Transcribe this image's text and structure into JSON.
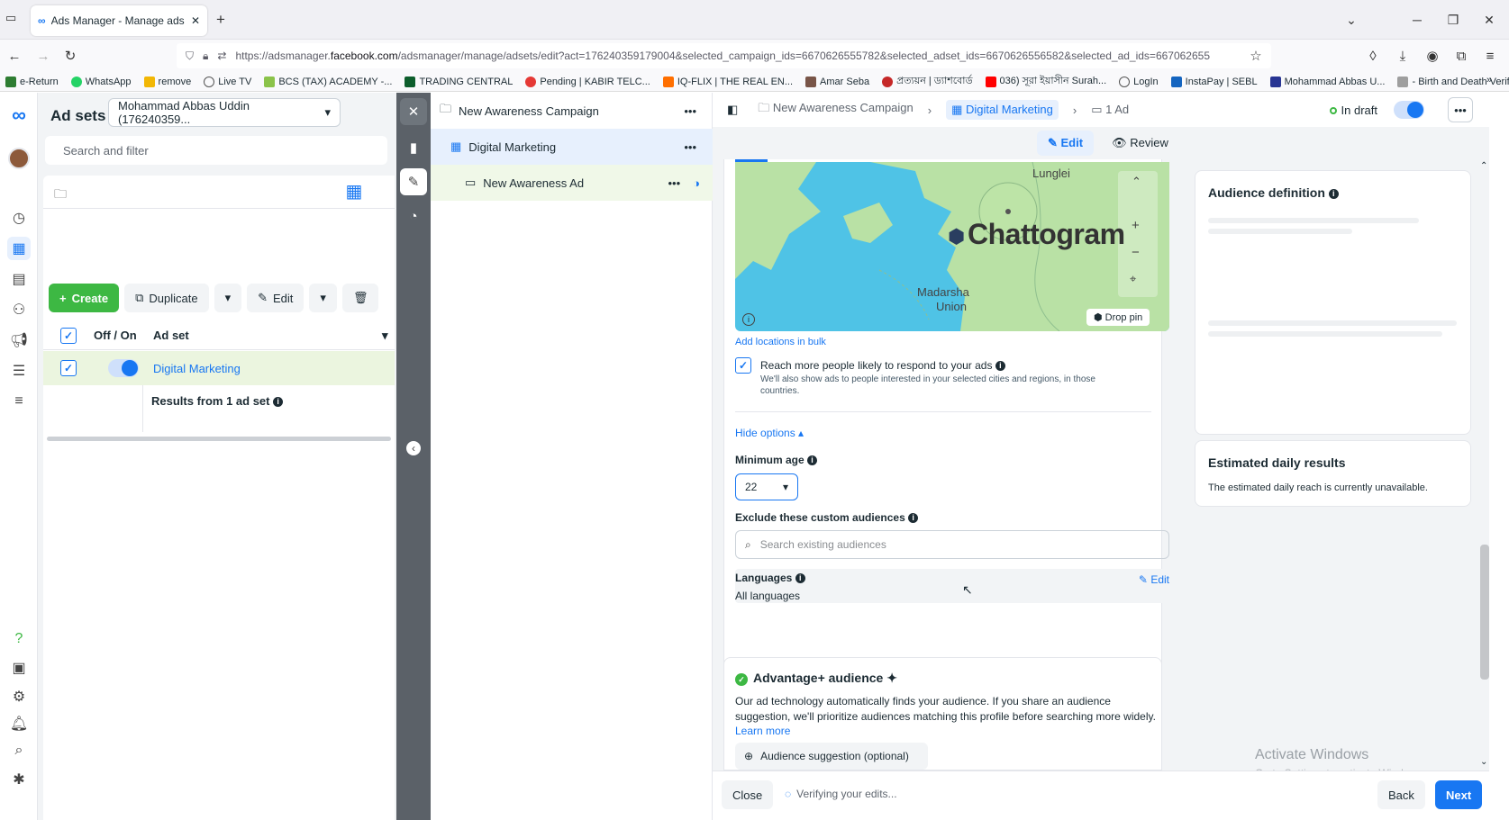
{
  "browser": {
    "tab_title": "Ads Manager - Manage ads - A",
    "url_prefix": "https://adsmanager.",
    "url_domain": "facebook.com",
    "url_rest": "/adsmanager/manage/adsets/edit?act=176240359179004&selected_campaign_ids=6670626555782&selected_adset_ids=6670626556582&selected_ad_ids=667062655",
    "bookmarks": [
      "e-Return",
      "WhatsApp",
      "remove",
      "Live TV",
      "BCS (TAX) ACADEMY -...",
      "TRADING CENTRAL",
      "Pending | KABIR TELC...",
      "IQ-FLIX | THE REAL EN...",
      "Amar Seba",
      "প্রত্যয়ন | ড্যাশবোর্ড",
      "036) সূরা ইয়াসীন Surah...",
      "LogIn",
      "InstaPay | SEBL",
      "Mohammad Abbas U...",
      "- Birth and Death Verifi..."
    ]
  },
  "adsets_panel": {
    "title": "Ad sets",
    "account": "Mohammad Abbas Uddin (176240359...",
    "search_placeholder": "Search and filter",
    "create_label": "Create",
    "duplicate_label": "Duplicate",
    "edit_label": "Edit",
    "col_toggle": "Off / On",
    "col_adset": "Ad set",
    "row_name": "Digital Marketing",
    "results_text": "Results from 1 ad set"
  },
  "tree": {
    "campaign": "New Awareness Campaign",
    "adset": "Digital Marketing",
    "ad": "New Awareness Ad"
  },
  "editor": {
    "breadcrumb_campaign": "New Awareness Campaign",
    "breadcrumb_adset": "Digital Marketing",
    "breadcrumb_ad": "1 Ad",
    "status": "In draft",
    "edit_tab": "Edit",
    "review_tab": "Review",
    "map": {
      "city": "Chattogram",
      "place_1": "Lunglei",
      "place_2": "Madarsha",
      "place_3": "Union",
      "drop_pin": "Drop pin"
    },
    "add_bulk": "Add locations in bulk",
    "reach_more_title": "Reach more people likely to respond to your ads",
    "reach_more_desc": "We'll also show ads to people interested in your selected cities and regions, in those countries.",
    "hide_options": "Hide options",
    "min_age_label": "Minimum age",
    "min_age_value": "22",
    "exclude_label": "Exclude these custom audiences",
    "exclude_placeholder": "Search existing audiences",
    "languages_label": "Languages",
    "languages_edit": "Edit",
    "languages_value": "All languages",
    "advantage_title": "Advantage+ audience",
    "advantage_desc": "Our ad technology automatically finds your audience. If you share an audience suggestion, we'll prioritize audiences matching this profile before searching more widely.",
    "learn_more": "Learn more",
    "audience_suggestion": "Audience suggestion (optional)",
    "audience_def_title": "Audience definition",
    "est_title": "Estimated daily results",
    "est_desc": "The estimated daily reach is currently unavailable.",
    "close_label": "Close",
    "verifying": "Verifying your edits...",
    "back_label": "Back",
    "next_label": "Next",
    "watermark_1": "Activate Windows",
    "watermark_2": "Go to Settings to activate Windows."
  },
  "colors": {
    "accent": "#1877f2",
    "green": "#3db843",
    "map_land": "#b9e1a5",
    "map_water": "#4fc3e6"
  }
}
